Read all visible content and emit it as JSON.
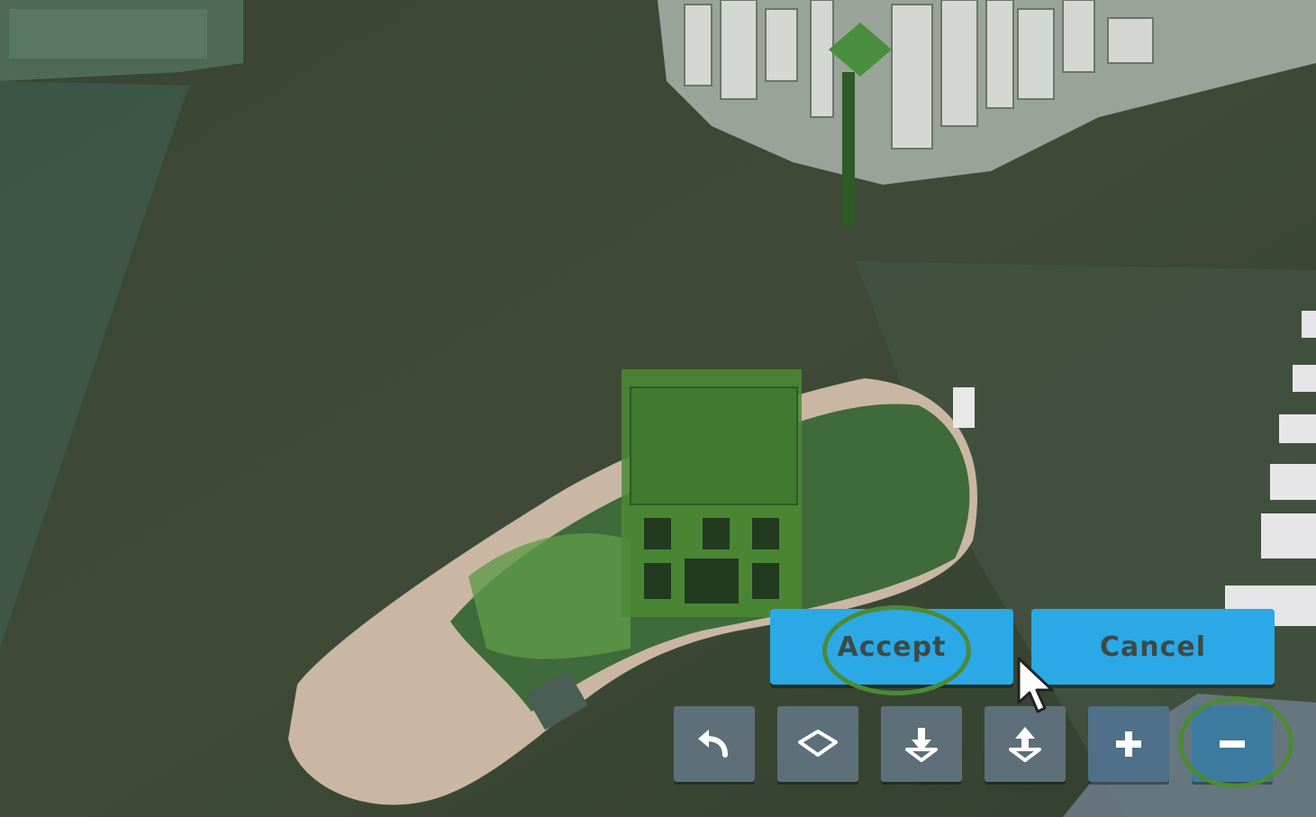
{
  "confirm": {
    "accept_label": "Accept",
    "cancel_label": "Cancel"
  },
  "toolbar": {
    "tools": [
      {
        "name": "undo",
        "icon": "undo-arrow-icon"
      },
      {
        "name": "erase",
        "icon": "eraser-diamond-icon"
      },
      {
        "name": "import",
        "icon": "download-tray-icon"
      },
      {
        "name": "export",
        "icon": "upload-tray-icon"
      },
      {
        "name": "zoom-in",
        "icon": "plus-icon"
      },
      {
        "name": "zoom-out",
        "icon": "minus-icon"
      }
    ]
  },
  "colors": {
    "button_blue": "#2aa9e6",
    "button_text": "#3e4a45",
    "tool_gray": "#5d7079",
    "highlight_ring": "#4c8a34",
    "selection_green": "#4c8a34",
    "water": "#3c4634"
  }
}
